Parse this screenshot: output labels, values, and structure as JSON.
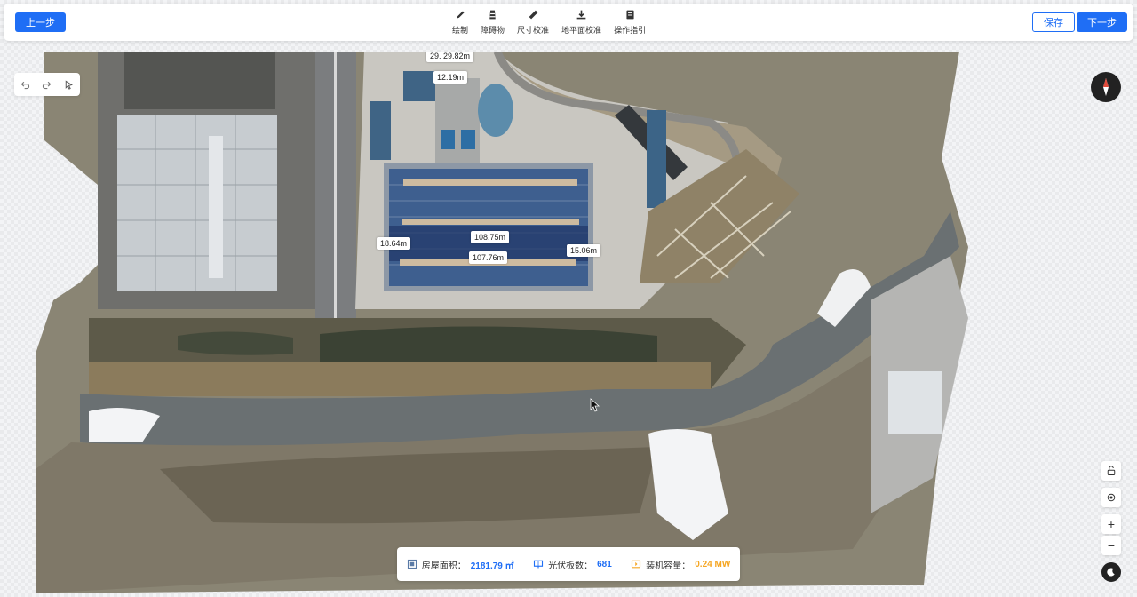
{
  "toolbar": {
    "prev_label": "上一步",
    "save_label": "保存",
    "next_label": "下一步",
    "tools": [
      {
        "label": "绘制",
        "icon": "pen-icon"
      },
      {
        "label": "障碍物",
        "icon": "obstacle-icon"
      },
      {
        "label": "尺寸校准",
        "icon": "ruler-icon"
      },
      {
        "label": "地平面校准",
        "icon": "ground-icon"
      },
      {
        "label": "操作指引",
        "icon": "guide-icon"
      }
    ]
  },
  "measurements": {
    "m1": "29. 29.82m",
    "m2": "12.19m",
    "m3": "18.64m",
    "m4": "108.75m",
    "m5": "15.06m",
    "m6": "107.76m"
  },
  "stats": {
    "area_label": "房屋面积：",
    "area_value": "2181.79 ㎡",
    "panels_label": "光伏板数：",
    "panels_value": "681",
    "capacity_label": "装机容量：",
    "capacity_value": "0.24 MW"
  },
  "colors": {
    "primary": "#1f6ef5",
    "capacity": "#f5a623"
  }
}
